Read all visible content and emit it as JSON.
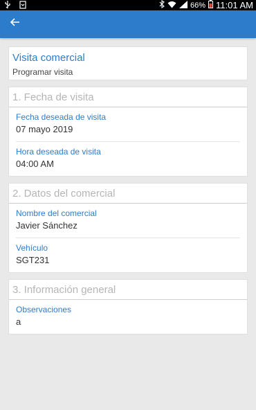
{
  "status_bar": {
    "battery": "66%",
    "time": "11:01 AM"
  },
  "header": {
    "title": "Visita comercial",
    "subtitle": "Programar visita"
  },
  "sections": [
    {
      "title": "1. Fecha de visita",
      "fields": [
        {
          "label": "Fecha deseada de visita",
          "value": "07 mayo 2019"
        },
        {
          "label": "Hora deseada de visita",
          "value": "04:00 AM"
        }
      ]
    },
    {
      "title": "2. Datos del comercial",
      "fields": [
        {
          "label": "Nombre del comercial",
          "value": "Javier Sánchez"
        },
        {
          "label": "Vehículo",
          "value": "SGT231"
        }
      ]
    },
    {
      "title": "3. Información general",
      "fields": [
        {
          "label": "Observaciones",
          "value": "a"
        }
      ]
    }
  ],
  "colors": {
    "accent": "#2d7ccc",
    "background": "#e9e9e9"
  },
  "icons": [
    "usb-icon",
    "download-icon",
    "bluetooth-icon",
    "wifi-icon",
    "signal-icon",
    "battery-icon",
    "back-arrow-icon"
  ]
}
